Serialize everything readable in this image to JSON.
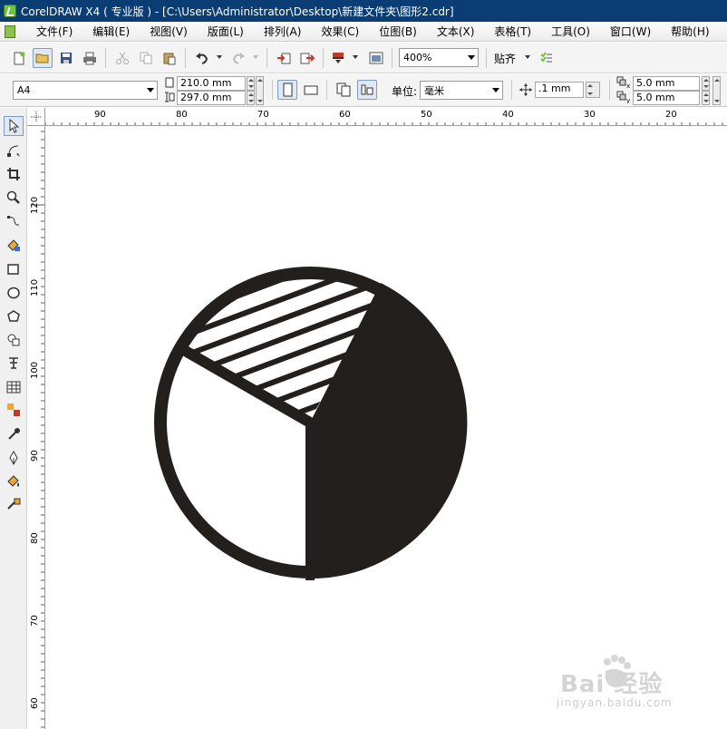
{
  "window": {
    "title": "CorelDRAW X4 ( 专业版 ) - [C:\\Users\\Administrator\\Desktop\\新建文件夹\\图形2.cdr]"
  },
  "menu": [
    "文件(F)",
    "编辑(E)",
    "视图(V)",
    "版面(L)",
    "排列(A)",
    "效果(C)",
    "位图(B)",
    "文本(X)",
    "表格(T)",
    "工具(O)",
    "窗口(W)",
    "帮助(H)"
  ],
  "toolbar": {
    "zoom": "400%",
    "snap_label": "贴齐"
  },
  "property_bar": {
    "page_size": "A4",
    "width": "210.0 mm",
    "height": "297.0 mm",
    "units_label": "单位:",
    "units_value": "毫米",
    "nudge": ".1 mm",
    "dup_x": "5.0 mm",
    "dup_y": "5.0 mm"
  },
  "rulers": {
    "horizontal_labels": [
      "90",
      "80",
      "70",
      "60",
      "50",
      "40",
      "30",
      "20"
    ],
    "vertical_labels": [
      "120",
      "110",
      "100",
      "90",
      "80",
      "70",
      "60"
    ]
  },
  "watermark": {
    "brand": "Bai 经验",
    "url": "jingyan.baidu.com"
  },
  "colors": {
    "titlebar": "#0a3d73",
    "shape_fill": "#231f1c",
    "selection": "#dfe9f6"
  },
  "icons": {
    "toolbox": [
      "pick-tool",
      "shape-tool",
      "crop-tool",
      "zoom-tool",
      "freehand-tool",
      "smart-fill-tool",
      "rectangle-tool",
      "ellipse-tool",
      "polygon-tool",
      "basic-shapes-tool",
      "text-tool",
      "table-tool",
      "interactive-blend-tool",
      "eyedropper-tool",
      "outline-pen-tool",
      "fill-tool",
      "interactive-fill-tool"
    ]
  }
}
